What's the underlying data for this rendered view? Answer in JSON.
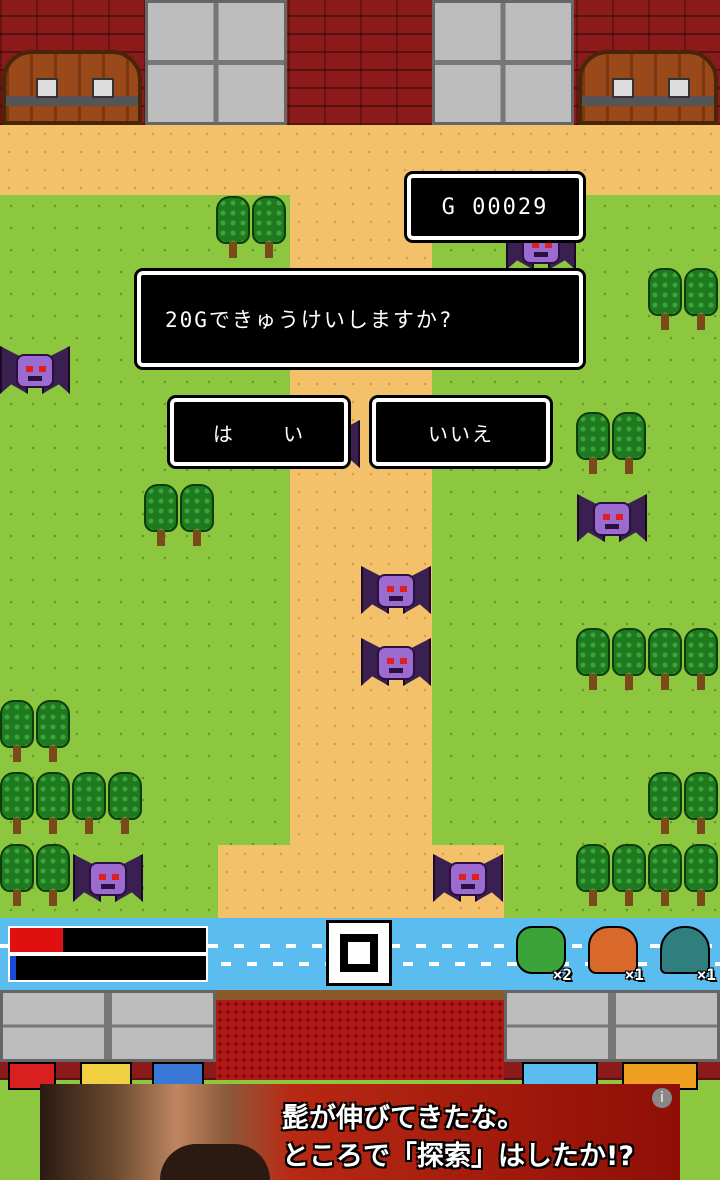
{
  "hud": {
    "gold_label": "G 00029",
    "hp_fraction": 0.27,
    "mp_fraction": 0.03,
    "items": [
      {
        "icon": "herb-icon",
        "count": "×2",
        "color": "#3aa33a"
      },
      {
        "icon": "meat-icon",
        "count": "×1",
        "color": "#d8692a"
      },
      {
        "icon": "scarab-icon",
        "count": "×1",
        "color": "#2f7f7f"
      }
    ]
  },
  "dialog": {
    "message": "20Gできゅうけいしますか?",
    "yes_label": "は い",
    "no_label": "いいえ"
  },
  "banner": {
    "line1": "髭が伸びてきたな。",
    "line2": "ところで「探索」はしたか!?",
    "info_glyph": "i"
  },
  "colors": {
    "hp": "#e01010",
    "mp": "#1a4ad8"
  }
}
